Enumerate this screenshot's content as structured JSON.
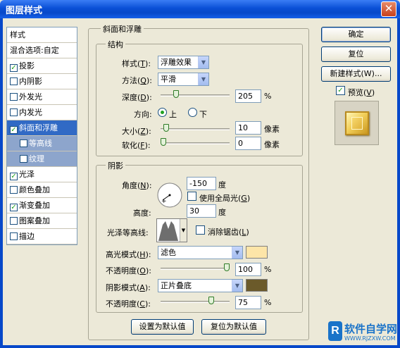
{
  "window": {
    "title": "图层样式",
    "close_glyph": "✕"
  },
  "styles_list": {
    "header": "样式",
    "items": [
      {
        "label": "混合选项:自定",
        "checkbox": false,
        "checked": false,
        "state": "plain"
      },
      {
        "label": "投影",
        "checkbox": true,
        "checked": true,
        "state": "plain"
      },
      {
        "label": "内阴影",
        "checkbox": true,
        "checked": false,
        "state": "plain"
      },
      {
        "label": "外发光",
        "checkbox": true,
        "checked": false,
        "state": "plain"
      },
      {
        "label": "内发光",
        "checkbox": true,
        "checked": false,
        "state": "plain"
      },
      {
        "label": "斜面和浮雕",
        "checkbox": true,
        "checked": true,
        "state": "selected"
      },
      {
        "label": "等高线",
        "checkbox": true,
        "checked": false,
        "state": "sub"
      },
      {
        "label": "纹理",
        "checkbox": true,
        "checked": false,
        "state": "sub"
      },
      {
        "label": "光泽",
        "checkbox": true,
        "checked": true,
        "state": "plain"
      },
      {
        "label": "颜色叠加",
        "checkbox": true,
        "checked": false,
        "state": "plain"
      },
      {
        "label": "渐变叠加",
        "checkbox": true,
        "checked": true,
        "state": "plain"
      },
      {
        "label": "图案叠加",
        "checkbox": true,
        "checked": false,
        "state": "plain"
      },
      {
        "label": "描边",
        "checkbox": true,
        "checked": false,
        "state": "plain"
      }
    ]
  },
  "bevel": {
    "section_title": "斜面和浮雕",
    "structure": {
      "title": "结构",
      "style_label": "样式(",
      "style_key": "T",
      "style_value": "浮雕效果",
      "technique_label": "方法(",
      "technique_key": "Q",
      "technique_value": "平滑",
      "depth_label": "深度(",
      "depth_key": "D",
      "depth_value": "205",
      "depth_unit": "%",
      "depth_level": 0.205,
      "direction_label": "方向:",
      "direction_up": "上",
      "direction_down": "下",
      "direction_selected": "上",
      "size_label": "大小(",
      "size_key": "Z",
      "size_value": "10",
      "size_unit": "像素",
      "size_level": 0.04,
      "soften_label": "软化(",
      "soften_key": "F",
      "soften_value": "0",
      "soften_unit": "像素",
      "soften_level": 0.0
    },
    "shading": {
      "title": "阴影",
      "angle_label": "角度(",
      "angle_key": "N",
      "angle_value": "-150",
      "angle_unit": "度",
      "global_light_label": "使用全局光(",
      "global_light_key": "G",
      "global_light_checked": false,
      "altitude_label": "高度:",
      "altitude_value": "30",
      "altitude_unit": "度",
      "gloss_contour_label": "光泽等高线:",
      "anti_alias_label": "消除锯齿(",
      "anti_alias_key": "L",
      "anti_alias_checked": false,
      "highlight_mode_label": "高光模式(",
      "highlight_mode_key": "H",
      "highlight_mode_value": "滤色",
      "highlight_color": "#fde5a8",
      "highlight_opacity_label": "不透明度(",
      "highlight_opacity_key": "O",
      "highlight_opacity_value": "100",
      "highlight_opacity_level": 1.0,
      "shadow_mode_label": "阴影模式(",
      "shadow_mode_key": "A",
      "shadow_mode_value": "正片叠底",
      "shadow_color": "#6b5a2a",
      "shadow_opacity_label": "不透明度(",
      "shadow_opacity_key": "C",
      "shadow_opacity_value": "75",
      "shadow_opacity_level": 0.75,
      "percent": "%"
    },
    "make_default": "设置为默认值",
    "reset_default": "复位为默认值"
  },
  "buttons": {
    "ok": "确定",
    "reset": "复位",
    "new_style": "新建样式(W)...",
    "preview_label": "预览(",
    "preview_key": "V",
    "preview_checked": true
  },
  "watermark": {
    "text": "软件自学网",
    "url": "WWW.RJZXW.COM"
  },
  "colors": {
    "accent": "#316ac5",
    "title_bar": "#0a4fd6"
  }
}
